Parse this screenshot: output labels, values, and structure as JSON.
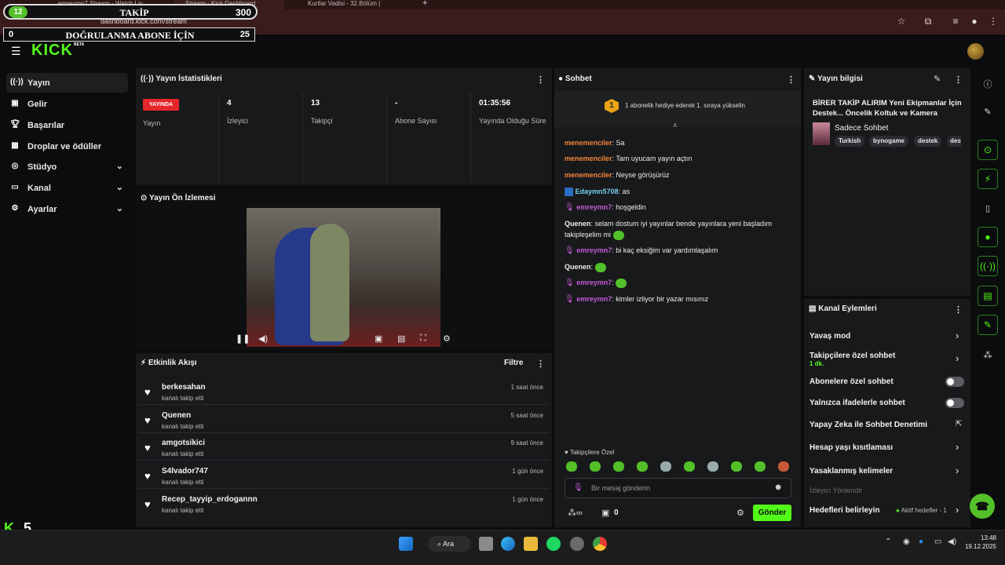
{
  "browser": {
    "tabs": [
      "emreymn7 Stream - Watch Liv",
      "Stream - Kick Dashboard",
      "Kurtlar Vadisi - 32.Bölüm |"
    ],
    "url": "dashboard.kick.com/stream"
  },
  "overlay": {
    "follow_goal": {
      "current": "12",
      "label": "TAKİP",
      "target": "300"
    },
    "sub_goal": {
      "current": "0",
      "label": "DOĞRULANMA ABONE İÇİN",
      "target": "25"
    },
    "kick_badge": "5"
  },
  "header": {
    "logo": "KICK",
    "beta": "BETA"
  },
  "sidebar": {
    "items": [
      {
        "label": "Yayın",
        "icon": "broadcast-icon"
      },
      {
        "label": "Gelir",
        "icon": "revenue-icon"
      },
      {
        "label": "Başarılar",
        "icon": "trophy-icon"
      },
      {
        "label": "Droplar ve ödüller",
        "icon": "gift-icon"
      },
      {
        "label": "Stüdyo",
        "icon": "studio-icon"
      },
      {
        "label": "Kanal",
        "icon": "channel-icon"
      },
      {
        "label": "Ayarlar",
        "icon": "gear-icon"
      }
    ]
  },
  "stats": {
    "title": "Yayın İstatistikleri",
    "live_badge": "YAYINDA",
    "live_label": "Yayın",
    "cols": [
      {
        "value": "4",
        "label": "İzleyici"
      },
      {
        "value": "13",
        "label": "Takipçi"
      },
      {
        "value": "-",
        "label": "Abone Sayısı"
      },
      {
        "value": "01:35:56",
        "label": "Yayında Olduğu Süre"
      }
    ]
  },
  "preview": {
    "title": "Yayın Ön İzlemesi"
  },
  "activity": {
    "title": "Etkinlik Akışı",
    "filter": "Filtre",
    "rows": [
      {
        "name": "berkesahan",
        "sub": "kanalı takip etti",
        "time": "1 saat önce"
      },
      {
        "name": "Quenen",
        "sub": "kanalı takip etti",
        "time": "5 saat önce"
      },
      {
        "name": "amgotsikici",
        "sub": "kanalı takip etti",
        "time": "9 saat önce"
      },
      {
        "name": "S4lvador747",
        "sub": "kanalı takip etti",
        "time": "1 gün önce"
      },
      {
        "name": "Recep_tayyip_erdogannn",
        "sub": "kanalı takip etti",
        "time": "1 gün önce"
      }
    ]
  },
  "chat": {
    "title": "Sohbet",
    "pinned_rank": "1",
    "pinned_text": "1 abonelik hediye ederek 1. sıraya yükselin",
    "messages": [
      {
        "user": "menemenciler",
        "text": "Sa"
      },
      {
        "user": "menemenciler",
        "text": "Tam uyucam yayın açtın"
      },
      {
        "user": "menemenciler",
        "text": "Neyse görüşürüz"
      },
      {
        "user": "Edaymn5708",
        "text": "as"
      },
      {
        "user": "emreymn7",
        "text": "hoşgeldin"
      },
      {
        "user": "Quenen",
        "text": "selam dostum iyi yayınlar bende yayınlara yeni başladım takipleşelim mi"
      },
      {
        "user": "emreymn7",
        "text": "bi kaç eksiğim var yardımlaşalım"
      },
      {
        "user": "Quenen",
        "text": ""
      },
      {
        "user": "emreymn7",
        "text": ""
      },
      {
        "user": "emreymn7",
        "text": "kimler izliyor bir yazar mısınız"
      }
    ],
    "emote_title": "Takipçilere Özel",
    "input_placeholder": "Bir mesaj gönderin",
    "count": "0",
    "send": "Gönder"
  },
  "info": {
    "title": "Yayın bilgisi",
    "stream_title": "BİRER TAKİP ALIRIM Yeni Ekipmanlar İçin Destek... Öncelik Koltuk ve Kamera",
    "category": "Sadece Sohbet",
    "tags": [
      "Turkish",
      "bynogame",
      "destek",
      "des"
    ]
  },
  "actions": {
    "title": "Kanal Eylemleri",
    "items": [
      {
        "label": "Yavaş mod"
      },
      {
        "label": "Takipçilere özel sohbet",
        "sub": "1 dk."
      },
      {
        "label": "Abonelere özel sohbet"
      },
      {
        "label": "Yalnızca ifadelerle sohbet"
      },
      {
        "label": "Yapay Zeka ile Sohbet Denetimi"
      },
      {
        "label": "Hesap yaşı kısıtlaması"
      },
      {
        "label": "Yasaklanmış kelimeler"
      },
      {
        "label": "İzleyici Yönlendir"
      },
      {
        "label": "Hedefleri belirleyin"
      }
    ],
    "goal_status": "Aktif hedefler - 1"
  },
  "taskbar": {
    "search": "Ara",
    "time": "13:48",
    "date": "19.12.2025"
  },
  "colors": {
    "accent": "#53fc18",
    "live": "#e5262a",
    "chat_user": "#f0853a",
    "mod_user": "#c65bd8"
  }
}
